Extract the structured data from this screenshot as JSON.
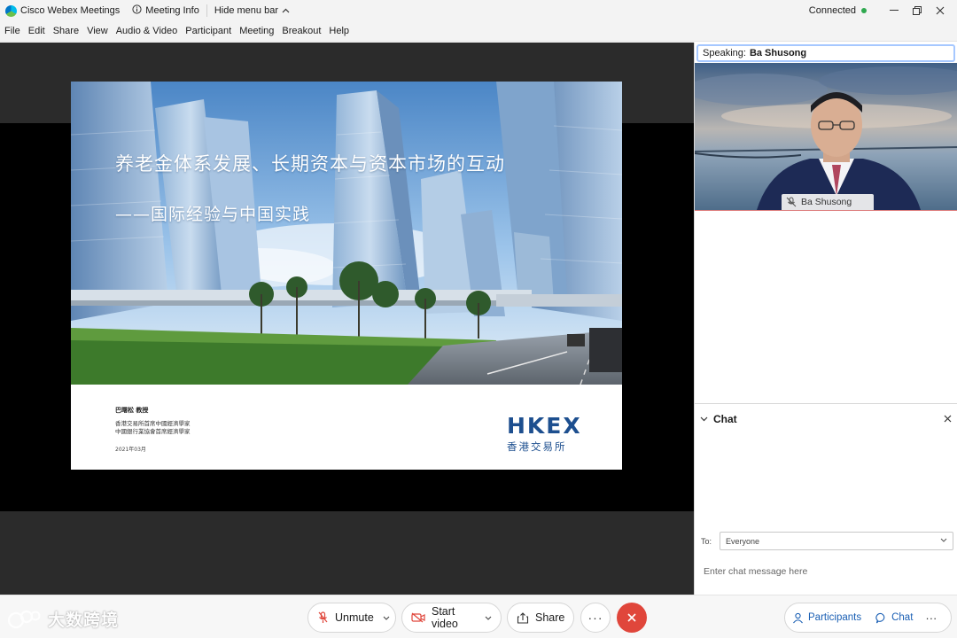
{
  "titlebar": {
    "app_title": "Cisco Webex Meetings",
    "meeting_info": "Meeting Info",
    "hide_menu_bar": "Hide menu bar",
    "status": "Connected",
    "status_color": "#2fa84f"
  },
  "menu": [
    "File",
    "Edit",
    "Share",
    "View",
    "Audio & Video",
    "Participant",
    "Meeting",
    "Breakout",
    "Help"
  ],
  "slide": {
    "title": "养老金体系发展、长期资本与资本市场的互动",
    "subtitle": "——国际经验与中国实践",
    "author_name": "巴曙松 教授",
    "author_line1": "香港交易所首席中國經濟學家",
    "author_line2": "中國銀行業協會首席經濟學家",
    "date": "2021年03月",
    "logo_text": "HKEX",
    "logo_cn": "香港交易所",
    "logo_color": "#1d4f8f"
  },
  "speaker": {
    "speaking_label": "Speaking:",
    "speaking_name": "Ba Shusong",
    "tile_name": "Ba Shusong"
  },
  "chat": {
    "header": "Chat",
    "to_label": "To:",
    "to_value": "Everyone",
    "input_placeholder": "Enter chat message here"
  },
  "toolbar": {
    "unmute": "Unmute",
    "start_video": "Start video",
    "share": "Share",
    "more": "···",
    "end_color": "#e0463b",
    "participants": "Participants",
    "chat": "Chat",
    "more_right": "···"
  },
  "watermark": {
    "text": "大数跨境"
  }
}
